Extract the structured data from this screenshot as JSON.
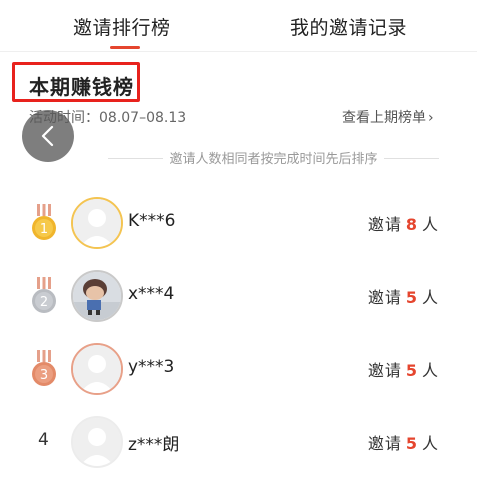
{
  "tabs": [
    {
      "label": "邀请排行榜",
      "active": true
    },
    {
      "label": "我的邀请记录",
      "active": false
    }
  ],
  "period_title": "本期赚钱榜",
  "activity_time": "活动时间：08.07–08.13",
  "prev_link": "查看上期榜单",
  "sort_note": "邀请人数相同者按完成时间先后排序",
  "colors": {
    "accent": "#e5452e",
    "highlight_box": "#e8221d",
    "gold": "#f0b52c",
    "silver": "#b9bcc1",
    "bronze": "#e38a68"
  },
  "ranking": [
    {
      "rank": "1",
      "medal": "gold",
      "name": "K***6",
      "invite_prefix": "邀请",
      "count": "8",
      "unit": "人"
    },
    {
      "rank": "2",
      "medal": "silver",
      "name": "x***4",
      "invite_prefix": "邀请",
      "count": "5",
      "unit": "人"
    },
    {
      "rank": "3",
      "medal": "bronze",
      "name": "y***3",
      "invite_prefix": "邀请",
      "count": "5",
      "unit": "人"
    },
    {
      "rank": "4",
      "medal": null,
      "name": "z***朗",
      "invite_prefix": "邀请",
      "count": "5",
      "unit": "人"
    }
  ]
}
